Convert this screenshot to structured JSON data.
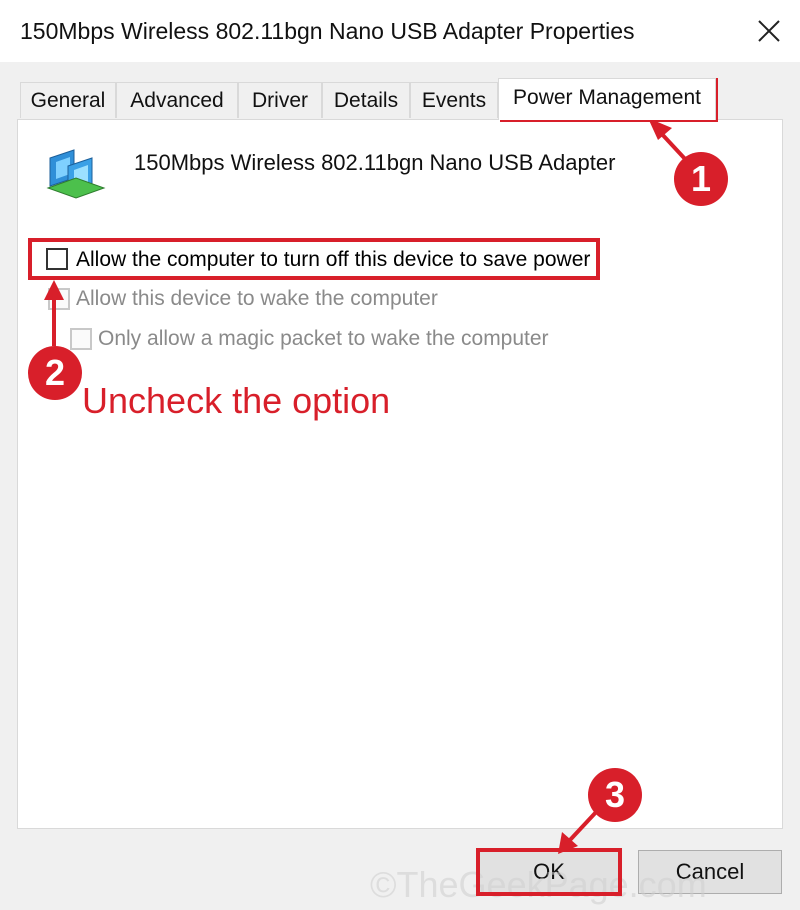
{
  "window": {
    "title": "150Mbps Wireless 802.11bgn Nano USB Adapter Properties"
  },
  "tabs": [
    {
      "label": "General"
    },
    {
      "label": "Advanced"
    },
    {
      "label": "Driver"
    },
    {
      "label": "Details"
    },
    {
      "label": "Events"
    },
    {
      "label": "Power Management",
      "active": true
    }
  ],
  "device": {
    "name": "150Mbps Wireless 802.11bgn Nano USB Adapter",
    "icon": "network-adapter-icon"
  },
  "options": [
    {
      "label": "Allow the computer to turn off this device to save power",
      "checked": false,
      "enabled": true
    },
    {
      "label": "Allow this device to wake the computer",
      "checked": false,
      "enabled": false
    },
    {
      "label": "Only allow a magic packet to wake the computer",
      "checked": false,
      "enabled": false
    }
  ],
  "annotations": {
    "step1": "1",
    "step2": "2",
    "step3": "3",
    "instruction": "Uncheck the option",
    "color": "#d81f2a"
  },
  "buttons": {
    "ok": "OK",
    "cancel": "Cancel"
  },
  "watermark": "©TheGeekPage.com"
}
